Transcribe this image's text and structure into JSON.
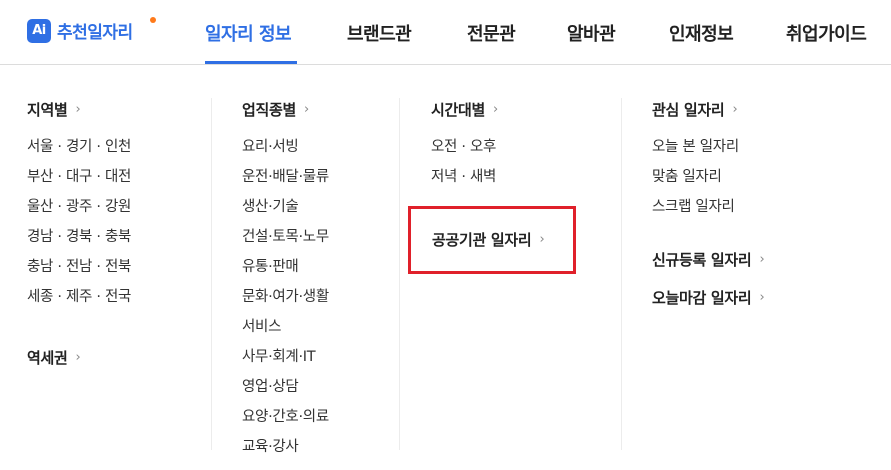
{
  "header": {
    "logo_badge": "Ai",
    "logo_text": "추천일자리",
    "nav": [
      "일자리 정보",
      "브랜드관",
      "전문관",
      "알바관",
      "인재정보",
      "취업가이드"
    ],
    "active_nav": "일자리 정보"
  },
  "menu": {
    "region": {
      "heading": "지역별",
      "items": [
        "서울 · 경기 · 인천",
        "부산 · 대구 · 대전",
        "울산 · 광주 · 강원",
        "경남 · 경북 · 충북",
        "충남 · 전남 · 전북",
        "세종 · 제주 · 전국"
      ],
      "station_heading": "역세권"
    },
    "job_type": {
      "heading": "업직종별",
      "items": [
        "요리·서빙",
        "운전·배달·물류",
        "생산·기술",
        "건설·토목·노무",
        "유통·판매",
        "문화·여가·생활",
        "서비스",
        "사무·회계·IT",
        "영업·상담",
        "요양·간호·의료",
        "교육·강사"
      ]
    },
    "time": {
      "heading": "시간대별",
      "items": [
        "오전 · 오후",
        "저녁 · 새벽"
      ],
      "public_jobs": "공공기관 일자리"
    },
    "interest": {
      "heading": "관심 일자리",
      "items": [
        "오늘 본 일자리",
        "맞춤 일자리",
        "스크랩 일자리"
      ],
      "new_heading": "신규등록 일자리",
      "closing_heading": "오늘마감 일자리"
    }
  },
  "colors": {
    "brand_blue": "#2f6fe4",
    "logo_dot": "#ff7a1a",
    "highlight_red": "#e0202a"
  }
}
